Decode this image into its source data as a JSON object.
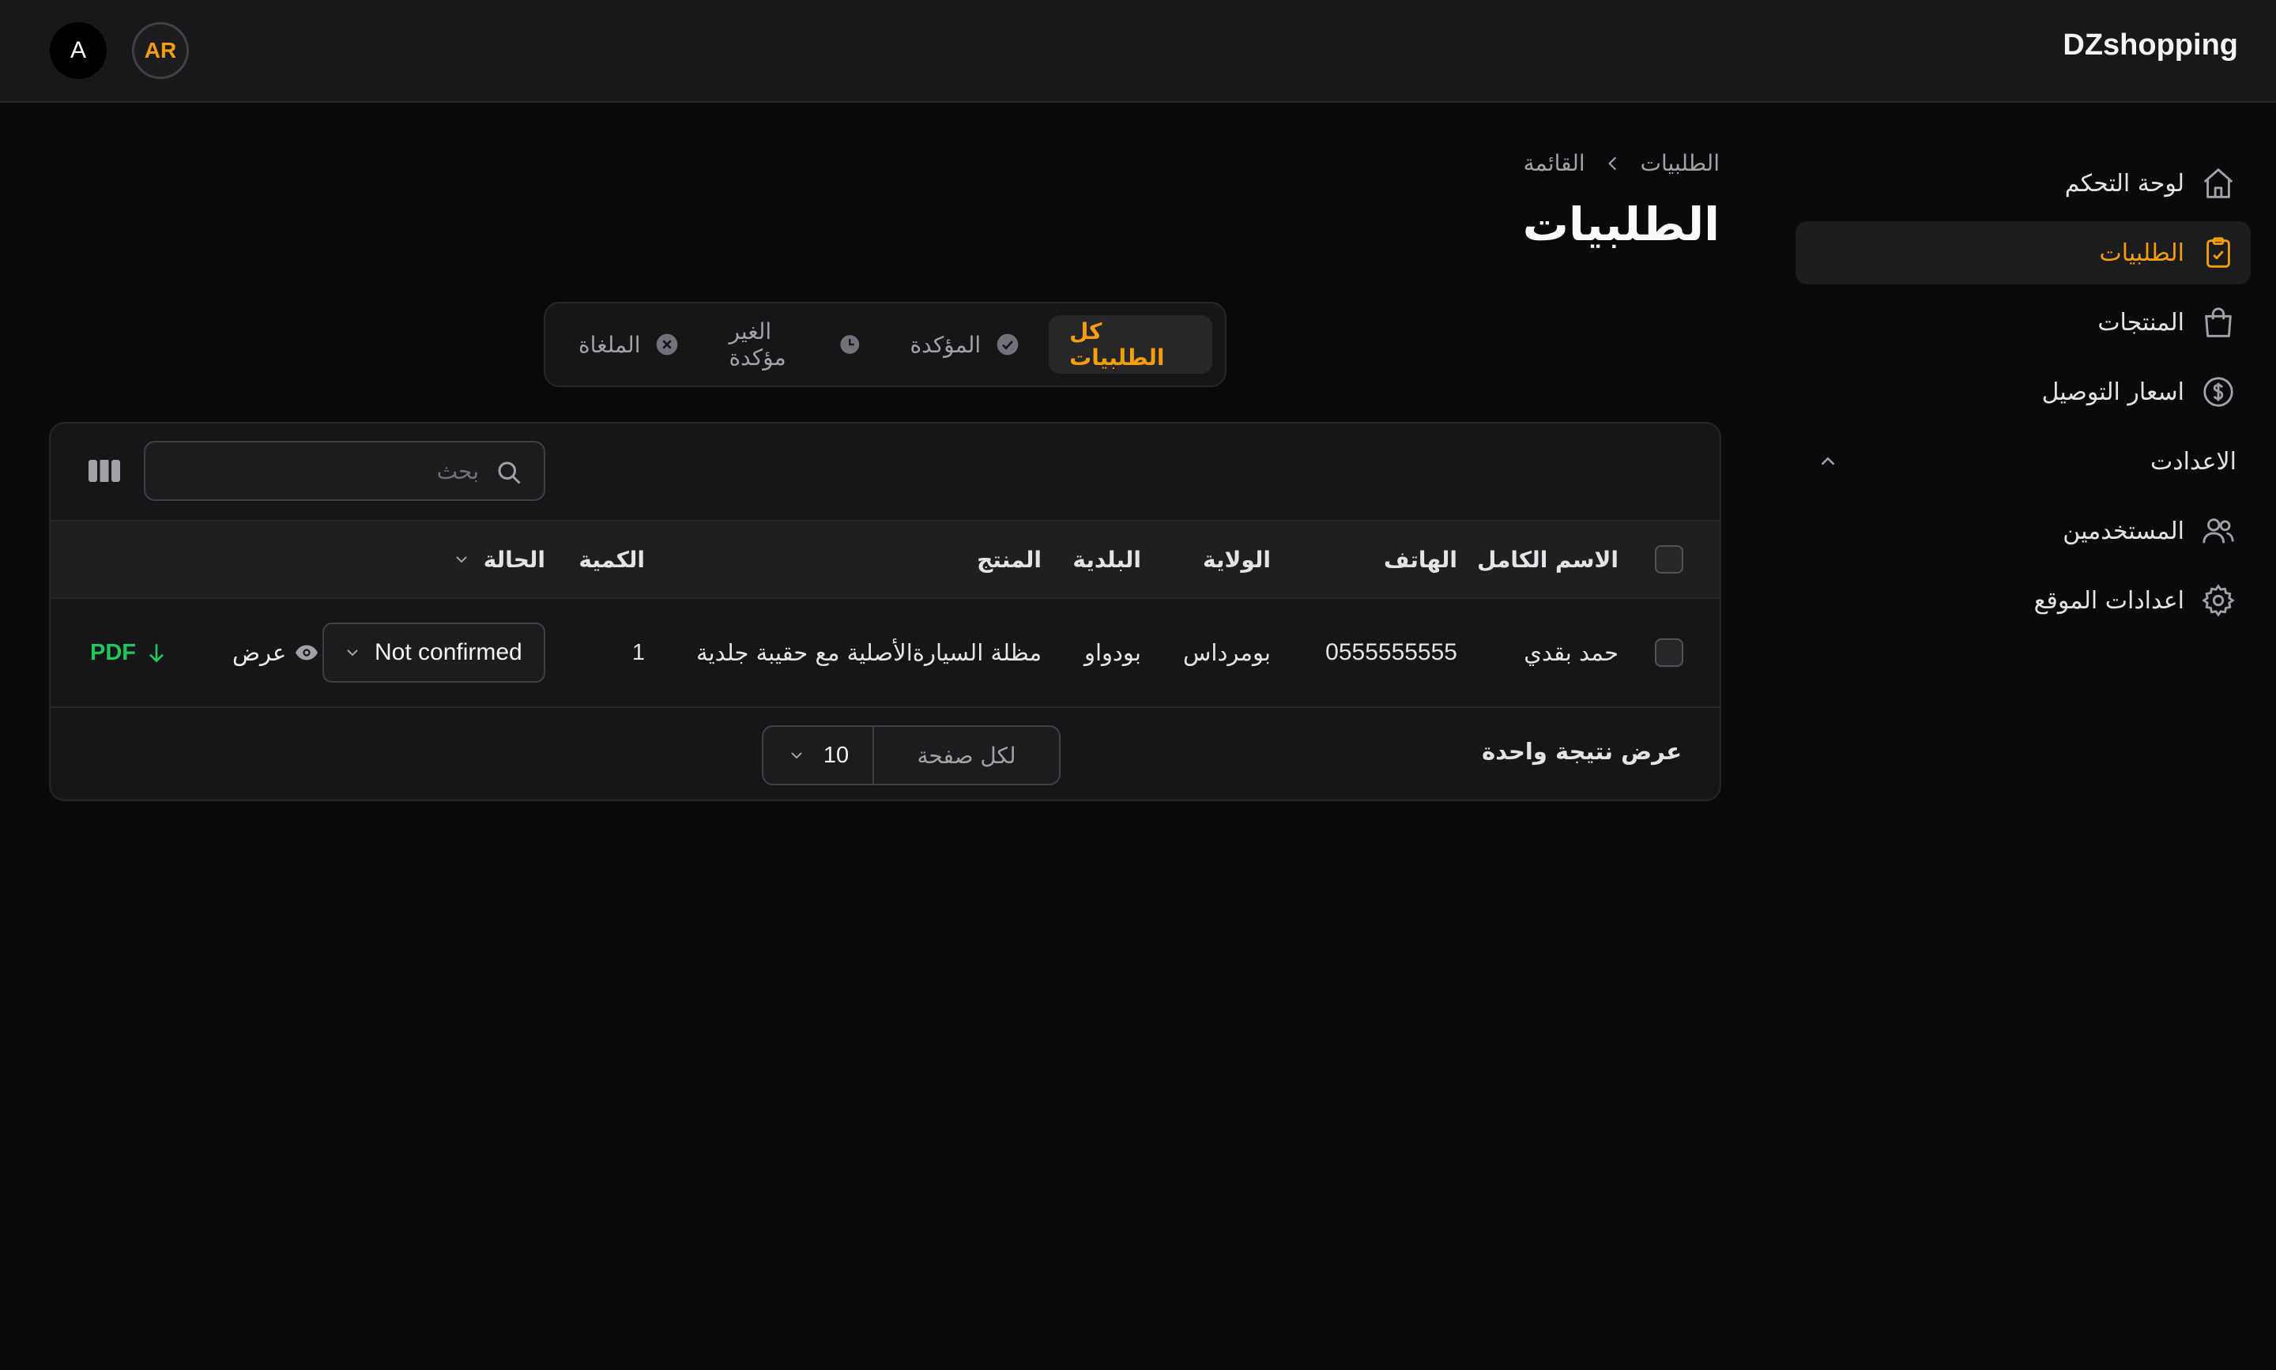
{
  "brand": "DZshopping",
  "header": {
    "user_initial": "A",
    "language": "AR"
  },
  "sidebar": {
    "items": [
      {
        "label": "لوحة التحكم",
        "icon": "home-icon"
      },
      {
        "label": "الطلبيات",
        "icon": "clipboard-check-icon",
        "active": true
      },
      {
        "label": "المنتجات",
        "icon": "shopping-bag-icon"
      },
      {
        "label": "اسعار التوصيل",
        "icon": "dollar-circle-icon"
      }
    ],
    "settings_group": "الاعدادت",
    "settings_items": [
      {
        "label": "المستخدمين",
        "icon": "users-icon"
      },
      {
        "label": "اعدادات الموقع",
        "icon": "gear-icon"
      }
    ]
  },
  "breadcrumb": {
    "parent": "الطلبيات",
    "current": "القائمة"
  },
  "page_title": "الطلبيات",
  "tabs": [
    {
      "label": "كل الطلبيات",
      "active": true
    },
    {
      "label": "المؤكدة",
      "icon": "check-circle-icon"
    },
    {
      "label": "الغير مؤكدة",
      "icon": "clock-icon"
    },
    {
      "label": "الملغاة",
      "icon": "x-circle-icon"
    }
  ],
  "search": {
    "placeholder": "بحث"
  },
  "table": {
    "columns": {
      "name": "الاسم الكامل",
      "phone": "الهاتف",
      "state": "الولاية",
      "city": "البلدية",
      "product": "المنتج",
      "quantity": "الكمية",
      "status": "الحالة"
    },
    "rows": [
      {
        "name": "حمد بقدي",
        "phone": "0555555555",
        "state": "بومرداس",
        "city": "بودواو",
        "product": "مظلة السيارةالأصلية مع حقيبة جلدية",
        "quantity": "1",
        "status": "Not confirmed",
        "view_label": "عرض",
        "pdf_label": "PDF"
      }
    ]
  },
  "footer": {
    "results": "عرض نتيجة واحدة",
    "per_page_label": "لكل صفحة",
    "per_page_value": "10"
  },
  "colors": {
    "accent": "#f59e0b",
    "pdf": "#22c55e",
    "background": "#0a0a0c"
  }
}
